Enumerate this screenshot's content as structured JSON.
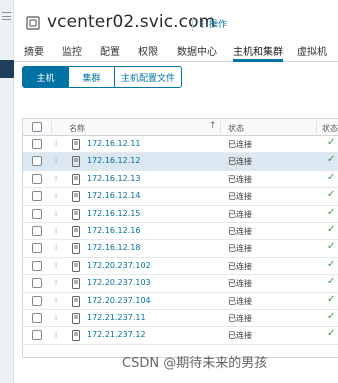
{
  "header": {
    "title": "vcenter02.svic.com",
    "actions_label": "操作"
  },
  "tabs": [
    {
      "label": "摘要"
    },
    {
      "label": "监控"
    },
    {
      "label": "配置"
    },
    {
      "label": "权限"
    },
    {
      "label": "数据中心"
    },
    {
      "label": "主机和集群",
      "active": true
    },
    {
      "label": "虚拟机"
    }
  ],
  "subtabs": [
    {
      "label": "主机",
      "active": true
    },
    {
      "label": "集群"
    },
    {
      "label": "主机配置文件"
    }
  ],
  "grid": {
    "columns": {
      "name": "名称",
      "state": "状态",
      "status": "状态"
    },
    "sort_indicator": "↑",
    "rows": [
      {
        "name": "172.16.12.11",
        "state": "已连接",
        "status": "✓"
      },
      {
        "name": "172.16.12.12",
        "state": "已连接",
        "status": "✓",
        "selected": true
      },
      {
        "name": "172.16.12.13",
        "state": "已连接",
        "status": "✓"
      },
      {
        "name": "172.16.12.14",
        "state": "已连接",
        "status": "✓"
      },
      {
        "name": "172.16.12.15",
        "state": "已连接",
        "status": "✓"
      },
      {
        "name": "172.16.12.16",
        "state": "已连接",
        "status": "✓"
      },
      {
        "name": "172.16.12.18",
        "state": "已连接",
        "status": "✓"
      },
      {
        "name": "172.20.237.102",
        "state": "已连接",
        "status": "✓"
      },
      {
        "name": "172.20.237.103",
        "state": "已连接",
        "status": "✓"
      },
      {
        "name": "172.20.237.104",
        "state": "已连接",
        "status": "✓"
      },
      {
        "name": "172.21.237.11",
        "state": "已连接",
        "status": "✓"
      },
      {
        "name": "172.21.237.12",
        "state": "已连接",
        "status": "✓"
      }
    ]
  },
  "watermark": "CSDN @期待未来的男孩",
  "colors": {
    "accent": "#0072a3",
    "selected_row": "#dbe7f1",
    "ok_green": "#3c9d3c",
    "nav_dark": "#1f3f5b"
  }
}
